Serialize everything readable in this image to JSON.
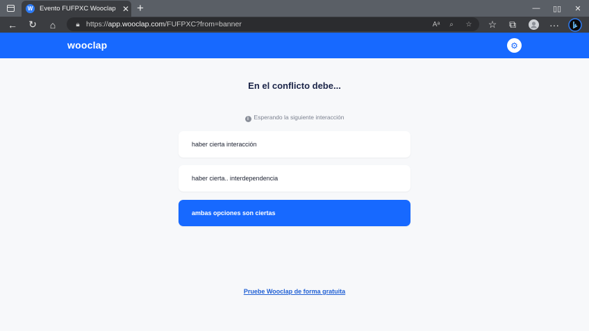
{
  "browser": {
    "tab_title": "Evento FUFPXC   Wooclap",
    "tab_favicon": "W",
    "url_prefix": "https://",
    "url_host": "app.wooclap.com",
    "url_path": "/FUFPXC?from=banner"
  },
  "app": {
    "logo": "wooclap",
    "accent_color": "#1769ff"
  },
  "main": {
    "question": "En el conflicto debe...",
    "info_icon": "i",
    "status": "Esperando la siguiente interacción",
    "options": [
      {
        "label": "haber cierta interacción",
        "selected": false
      },
      {
        "label": "haber cierta.. interdependencia",
        "selected": false
      },
      {
        "label": "ambas opciones son ciertas",
        "selected": true
      }
    ],
    "footer_link": "Pruebe Wooclap de forma gratuita"
  }
}
